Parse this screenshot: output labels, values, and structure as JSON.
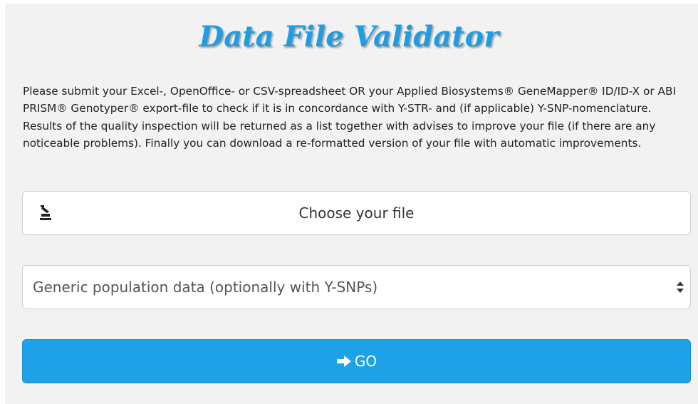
{
  "header": {
    "title": "Data File Validator"
  },
  "intro": {
    "text": "Please submit your Excel-, OpenOffice- or CSV-spreadsheet OR your Applied Biosystems® GeneMapper® ID/ID-X or ABI PRISM® Genotyper® export-file to check if it is in concordance with Y-STR- and (if applicable) Y-SNP-nomenclature. Results of the quality inspection will be returned as a list together with advises to improve your file (if there are any noticeable problems). Finally you can download a re-formatted version of your file with automatic improvements."
  },
  "file_picker": {
    "label": "Choose your file",
    "icon": "upload-icon"
  },
  "data_type_select": {
    "selected": "Generic population data (optionally with Y-SNPs)",
    "icon": "select-arrows-icon"
  },
  "submit": {
    "label": "GO",
    "icon": "arrow-right-icon"
  },
  "colors": {
    "title": "#1f9de0",
    "go_button": "#1ea2e7",
    "panel_background": "#f2f2f2"
  }
}
